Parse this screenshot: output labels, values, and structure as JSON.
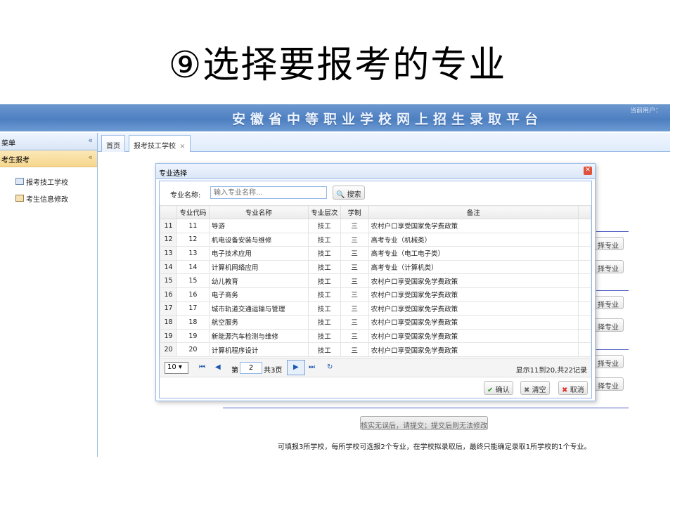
{
  "slide": {
    "title": "⑨选择要报考的专业"
  },
  "banner": {
    "title": "安徽省中等职业学校网上招生录取平台",
    "user": "当前用户："
  },
  "sidebar": {
    "header": "菜单",
    "collapse": "«",
    "section": "考生报考",
    "section_toggle": "«",
    "items": [
      {
        "label": "报考技工学校"
      },
      {
        "label": "考生信息修改"
      }
    ]
  },
  "tabs": [
    {
      "label": "首页"
    },
    {
      "label": "报考技工学校",
      "close": "×"
    }
  ],
  "background": {
    "buttons": [
      "择专业",
      "择专业",
      "择专业",
      "择专业",
      "择专业",
      "择专业"
    ],
    "submit": "核实无误后，请提交；提交后则无法修改",
    "notice": "可填报3所学校，每所学校可选报2个专业，在学校拟录取后，最终只能确定录取1所学校的1个专业。"
  },
  "dialog": {
    "title": "专业选择",
    "search_label": "专业名称:",
    "search_placeholder": "输入专业名称...",
    "search_button": "搜索",
    "columns": [
      "",
      "专业代码",
      "专业名称",
      "专业层次",
      "学制",
      "备注"
    ],
    "rows": [
      {
        "n": "11",
        "code": "11",
        "name": "导游",
        "level": "技工",
        "years": "三",
        "note": "农村户口享受国家免学费政策"
      },
      {
        "n": "12",
        "code": "12",
        "name": "机电设备安装与维修",
        "level": "技工",
        "years": "三",
        "note": "高考专业（机械类）"
      },
      {
        "n": "13",
        "code": "13",
        "name": "电子技术应用",
        "level": "技工",
        "years": "三",
        "note": "高考专业（电工电子类）"
      },
      {
        "n": "14",
        "code": "14",
        "name": "计算机网络应用",
        "level": "技工",
        "years": "三",
        "note": "高考专业（计算机类）"
      },
      {
        "n": "15",
        "code": "15",
        "name": "幼儿教育",
        "level": "技工",
        "years": "三",
        "note": "农村户口享受国家免学费政策"
      },
      {
        "n": "16",
        "code": "16",
        "name": "电子商务",
        "level": "技工",
        "years": "三",
        "note": "农村户口享受国家免学费政策"
      },
      {
        "n": "17",
        "code": "17",
        "name": "城市轨道交通运输与管理",
        "level": "技工",
        "years": "三",
        "note": "农村户口享受国家免学费政策"
      },
      {
        "n": "18",
        "code": "18",
        "name": "航空服务",
        "level": "技工",
        "years": "三",
        "note": "农村户口享受国家免学费政策"
      },
      {
        "n": "19",
        "code": "19",
        "name": "新能源汽车检测与维修",
        "level": "技工",
        "years": "三",
        "note": "农村户口享受国家免学费政策"
      },
      {
        "n": "20",
        "code": "20",
        "name": "计算机程序设计",
        "level": "技工",
        "years": "三",
        "note": "农村户口享受国家免学费政策"
      }
    ],
    "pager": {
      "page_size": "10",
      "page_prefix": "第",
      "page": "2",
      "page_suffix": "共3页",
      "info": "显示11到20,共22记录"
    },
    "buttons": {
      "confirm": "确认",
      "clear": "清空",
      "cancel": "取消"
    }
  },
  "colors": {
    "banner": "#4d7fc0",
    "border": "#95b8e7",
    "section": "#f6d78e"
  }
}
